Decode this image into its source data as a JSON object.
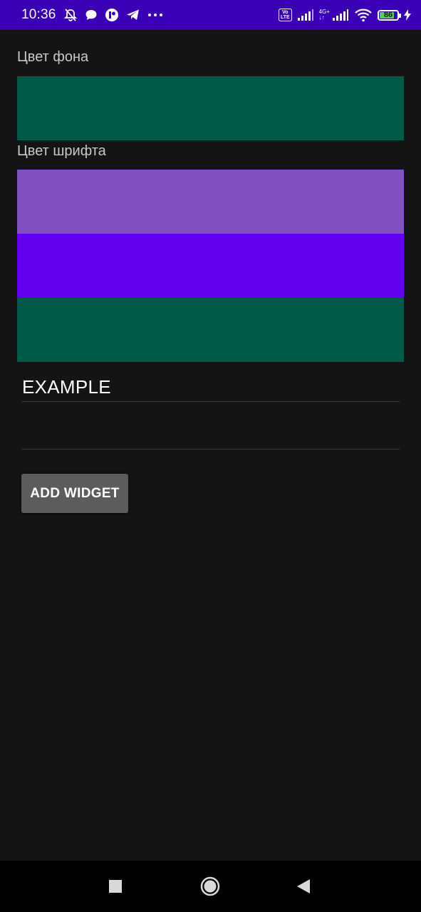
{
  "status_bar": {
    "time": "10:36",
    "volte_line1": "Vo",
    "volte_line2": "LTE",
    "network_top": "4G+",
    "network_bottom": "↓↑",
    "battery_level": 86,
    "battery_text": "86",
    "background": "#3a00b5"
  },
  "labels": {
    "background_color": "Цвет фона",
    "font_color": "Цвет шрифта"
  },
  "swatches": {
    "background_color": "#005a47",
    "font_options": [
      "#8151c2",
      "#6200ee",
      "#005a47"
    ]
  },
  "preview": {
    "text": "EXAMPLE"
  },
  "input": {
    "value": "",
    "placeholder": ""
  },
  "button": {
    "label": "ADD WIDGET"
  }
}
